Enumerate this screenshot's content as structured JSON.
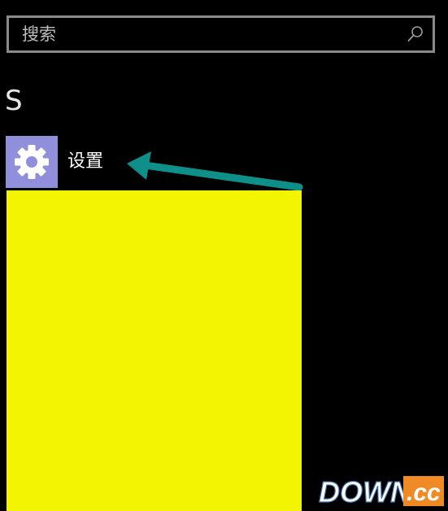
{
  "search": {
    "placeholder": "搜索",
    "value": "",
    "icon": "search-icon"
  },
  "group": {
    "letter": "S"
  },
  "app": {
    "label": "设置",
    "icon": "gear-icon",
    "tile_color": "#8f8fdc"
  },
  "annotation": {
    "arrow_color": "#0f8f8a",
    "highlight_color": "#f3f500"
  },
  "watermark": {
    "text_main": "DOWN",
    "text_suffix": ".cc"
  }
}
